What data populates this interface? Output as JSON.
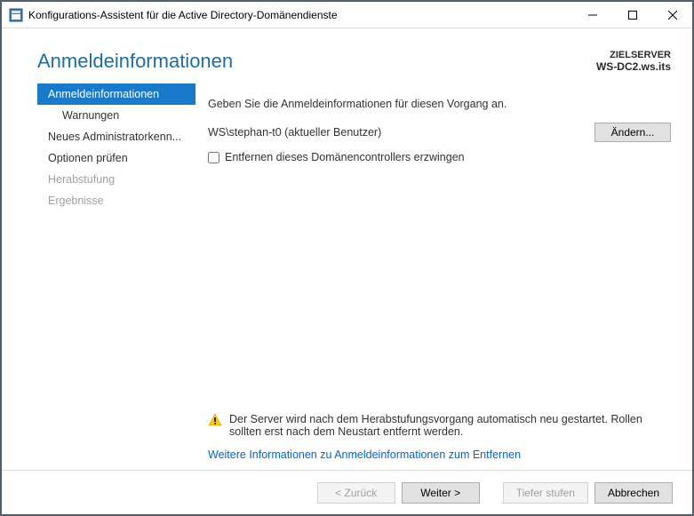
{
  "titlebar": {
    "title": "Konfigurations-Assistent für die Active Directory-Domänendienste"
  },
  "header": {
    "title": "Anmeldeinformationen",
    "target_label": "ZIELSERVER",
    "target_value": "WS-DC2.ws.its"
  },
  "sidebar": {
    "items": [
      {
        "label": "Anmeldeinformationen",
        "active": true,
        "child": false,
        "disabled": false
      },
      {
        "label": "Warnungen",
        "active": false,
        "child": true,
        "disabled": false
      },
      {
        "label": "Neues Administratorkenn...",
        "active": false,
        "child": false,
        "disabled": false
      },
      {
        "label": "Optionen prüfen",
        "active": false,
        "child": false,
        "disabled": false
      },
      {
        "label": "Herabstufung",
        "active": false,
        "child": false,
        "disabled": true
      },
      {
        "label": "Ergebnisse",
        "active": false,
        "child": false,
        "disabled": true
      }
    ]
  },
  "main": {
    "instruction": "Geben Sie die Anmeldeinformationen für diesen Vorgang an.",
    "current_user": "WS\\stephan-t0 (aktueller Benutzer)",
    "change_label": "Ändern...",
    "force_remove_label": "Entfernen dieses Domänencontrollers erzwingen",
    "force_remove_checked": false,
    "warning_text": "Der Server wird nach dem Herabstufungsvorgang automatisch neu gestartet. Rollen sollten erst nach dem Neustart entfernt werden.",
    "more_link": "Weitere Informationen zu Anmeldeinformationen zum Entfernen"
  },
  "footer": {
    "back": "< Zurück",
    "next": "Weiter >",
    "demote": "Tiefer stufen",
    "cancel": "Abbrechen"
  }
}
